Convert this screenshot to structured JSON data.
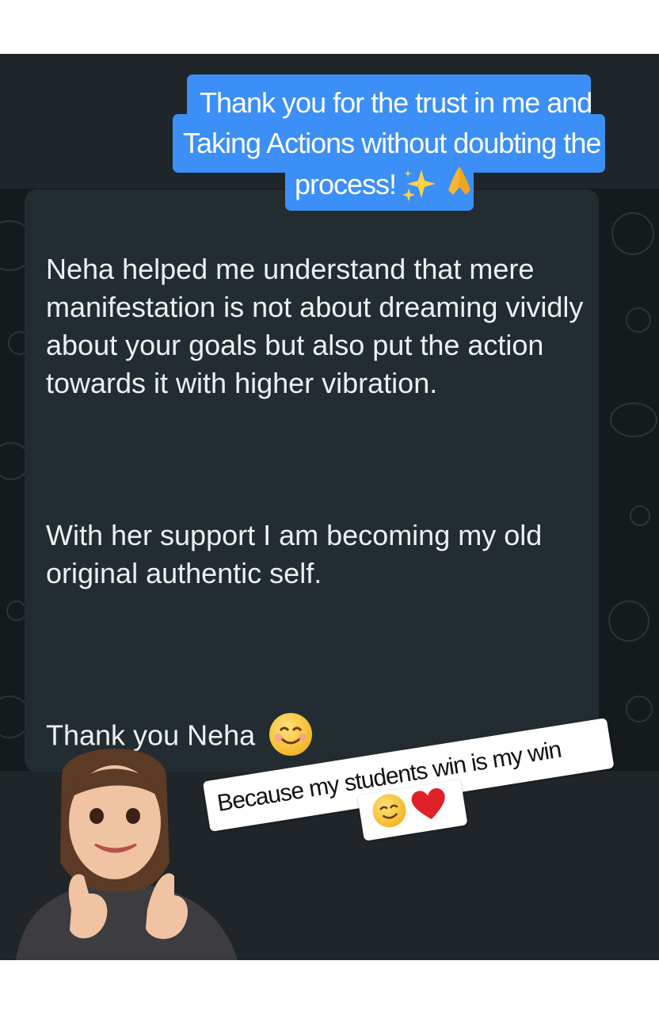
{
  "caption": {
    "lines": [
      "Thank you for the trust in me and",
      "Taking Actions without doubting the",
      "process!"
    ],
    "emojis": [
      "sparkles-icon",
      "folded-hands-icon"
    ],
    "color": "#3b8ff6"
  },
  "message": {
    "paragraph1": "Neha helped me understand that mere manifestation is not about dreaming vividly about your goals but also put the action towards it with higher vibration.",
    "paragraph2": "With her support I am becoming my old original authentic self.",
    "thanks": "Thank you Neha",
    "thanks_emoji": "smiling-face-icon"
  },
  "sticker": {
    "text": "Because my students win is my win",
    "emojis": [
      "smiling-face-icon",
      "red-heart-icon"
    ]
  },
  "avatar": {
    "description_icon": "thumbs-up-avatar-icon"
  },
  "colors": {
    "screen_bg": "#1f2528",
    "bubble_bg": "#232c30",
    "text": "#eef1f2"
  }
}
